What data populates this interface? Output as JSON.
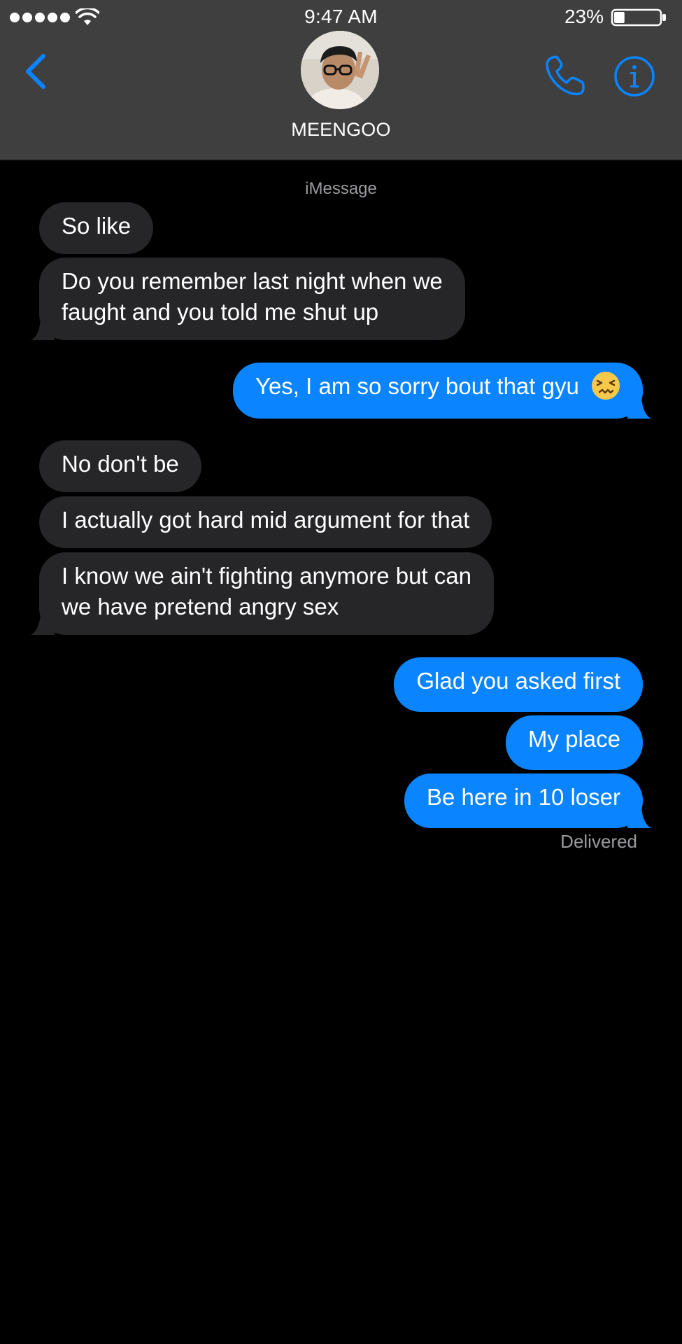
{
  "status_bar": {
    "time": "9:47 AM",
    "battery_percent": "23%",
    "battery_level": 0.23,
    "signal_bars": 5
  },
  "header": {
    "contact_name": "MEENGOO",
    "back_icon": "chevron-left-icon",
    "call_icon": "phone-icon",
    "info_icon": "info-icon",
    "accent_color": "#0a84ff"
  },
  "conversation": {
    "service_label": "iMessage",
    "messages": [
      {
        "direction": "incoming",
        "text": "So like"
      },
      {
        "direction": "incoming",
        "lines": [
          "Do you remember last night when we",
          "faught and you told me shut up"
        ]
      },
      {
        "direction": "outgoing",
        "text": "Yes, I am so sorry bout that gyu",
        "emoji": "confounded-face-icon"
      },
      {
        "direction": "incoming",
        "text": "No don't be"
      },
      {
        "direction": "incoming",
        "text": "I actually got hard mid argument for that"
      },
      {
        "direction": "incoming",
        "lines": [
          "I know we ain't fighting anymore but can",
          "we have pretend angry sex"
        ]
      },
      {
        "direction": "outgoing",
        "text": "Glad you asked first"
      },
      {
        "direction": "outgoing",
        "text": "My place"
      },
      {
        "direction": "outgoing",
        "text": "Be here in 10 loser"
      }
    ],
    "delivery_status": "Delivered"
  },
  "colors": {
    "background": "#000000",
    "header_bg": "#3f3f3f",
    "incoming_bubble": "#262629",
    "outgoing_bubble": "#0a84ff",
    "meta_text": "#9b9b9f"
  }
}
